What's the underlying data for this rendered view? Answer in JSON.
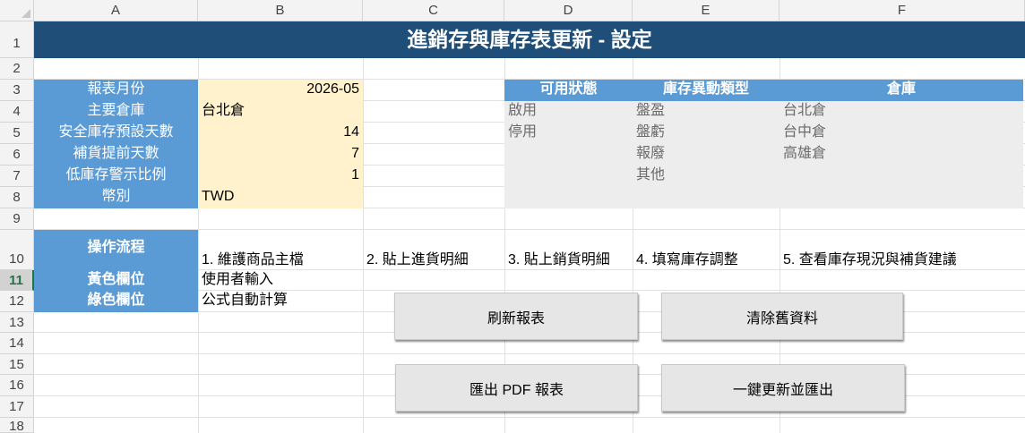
{
  "columns": [
    "A",
    "B",
    "C",
    "D",
    "E",
    "F"
  ],
  "rows": [
    "1",
    "2",
    "3",
    "4",
    "5",
    "6",
    "7",
    "8",
    "9",
    "10",
    "11",
    "12",
    "13",
    "14",
    "15",
    "16",
    "17",
    "18"
  ],
  "active_row": "11",
  "title": "進銷存與庫存表更新 - 設定",
  "settings": [
    {
      "label": "報表月份",
      "value": "2026-05",
      "align": "right"
    },
    {
      "label": "主要倉庫",
      "value": "台北倉",
      "align": "left"
    },
    {
      "label": "安全庫存預設天數",
      "value": "14",
      "align": "right"
    },
    {
      "label": "補貨提前天數",
      "value": "7",
      "align": "right"
    },
    {
      "label": "低庫存警示比例",
      "value": "1",
      "align": "right"
    },
    {
      "label": "幣別",
      "value": "TWD",
      "align": "left"
    }
  ],
  "lists": {
    "headers": [
      "可用狀態",
      "庫存異動類型",
      "倉庫"
    ],
    "status": [
      "啟用",
      "停用"
    ],
    "types": [
      "盤盈",
      "盤虧",
      "報廢",
      "其他"
    ],
    "warehouses": [
      "台北倉",
      "台中倉",
      "高雄倉"
    ]
  },
  "workflow": {
    "label": "操作流程",
    "steps": [
      "1. 維護商品主檔",
      "2. 貼上進貨明細",
      "3. 貼上銷貨明細",
      "4. 填寫庫存調整",
      "5. 查看庫存現況與補貨建議"
    ]
  },
  "legend": [
    {
      "label": "黃色欄位",
      "desc": "使用者輸入"
    },
    {
      "label": "綠色欄位",
      "desc": "公式自動計算"
    }
  ],
  "buttons": {
    "refresh": "刷新報表",
    "clear": "清除舊資料",
    "export_pdf": "匯出 PDF 報表",
    "update_export": "一鍵更新並匯出"
  },
  "colors": {
    "title_bg": "#1f4e79",
    "label_bg": "#5b9bd5",
    "input_bg": "#fff2cc",
    "list_bg": "#ededed"
  }
}
